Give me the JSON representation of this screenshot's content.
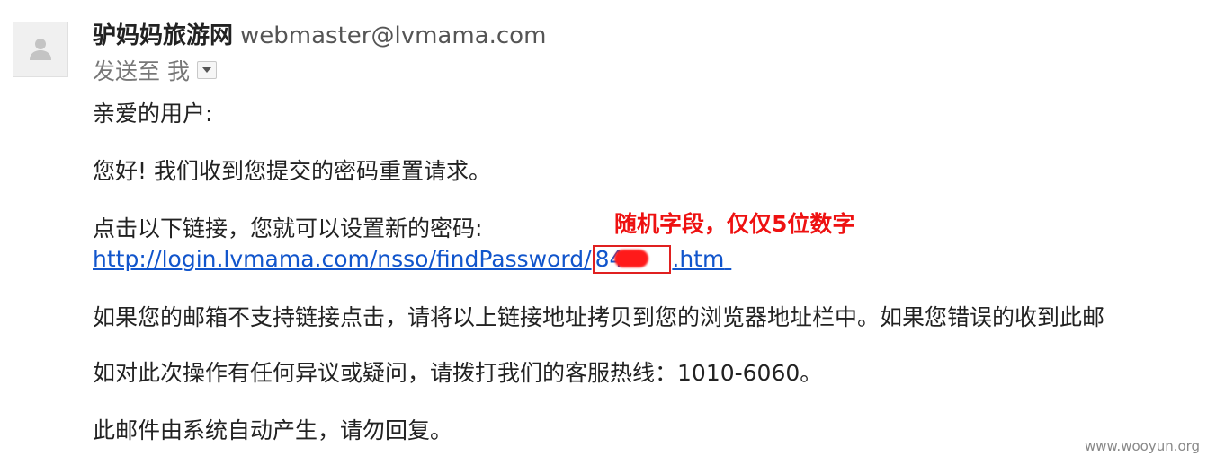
{
  "sender": {
    "name": "驴妈妈旅游网",
    "email": "webmaster@lvmama.com"
  },
  "recipient": {
    "label": "发送至 我"
  },
  "body": {
    "greeting": "亲爱的用户:",
    "hello": "您好! 我们收到您提交的密码重置请求。",
    "click_instruction": "点击以下链接，您就可以设置新的密码:",
    "link": {
      "prefix": "http://login.lvmama.com/nsso/findPassword/",
      "token_visible": "84",
      "suffix": ".htm"
    },
    "if_unsupported": "如果您的邮箱不支持链接点击，请将以上链接地址拷贝到您的浏览器地址栏中。如果您错误的收到此邮",
    "contact": "如对此次操作有任何异议或疑问，请拨打我们的客服热线：1010-6060。",
    "auto_generated": "此邮件由系统自动产生，请勿回复。"
  },
  "annotation": {
    "text": "随机字段，仅仅5位数字",
    "color": "#ee1111"
  },
  "watermark": "www.wooyun.org",
  "colors": {
    "link": "#1155cc",
    "highlight_box": "#e02020",
    "redaction": "#ff1a1a"
  }
}
